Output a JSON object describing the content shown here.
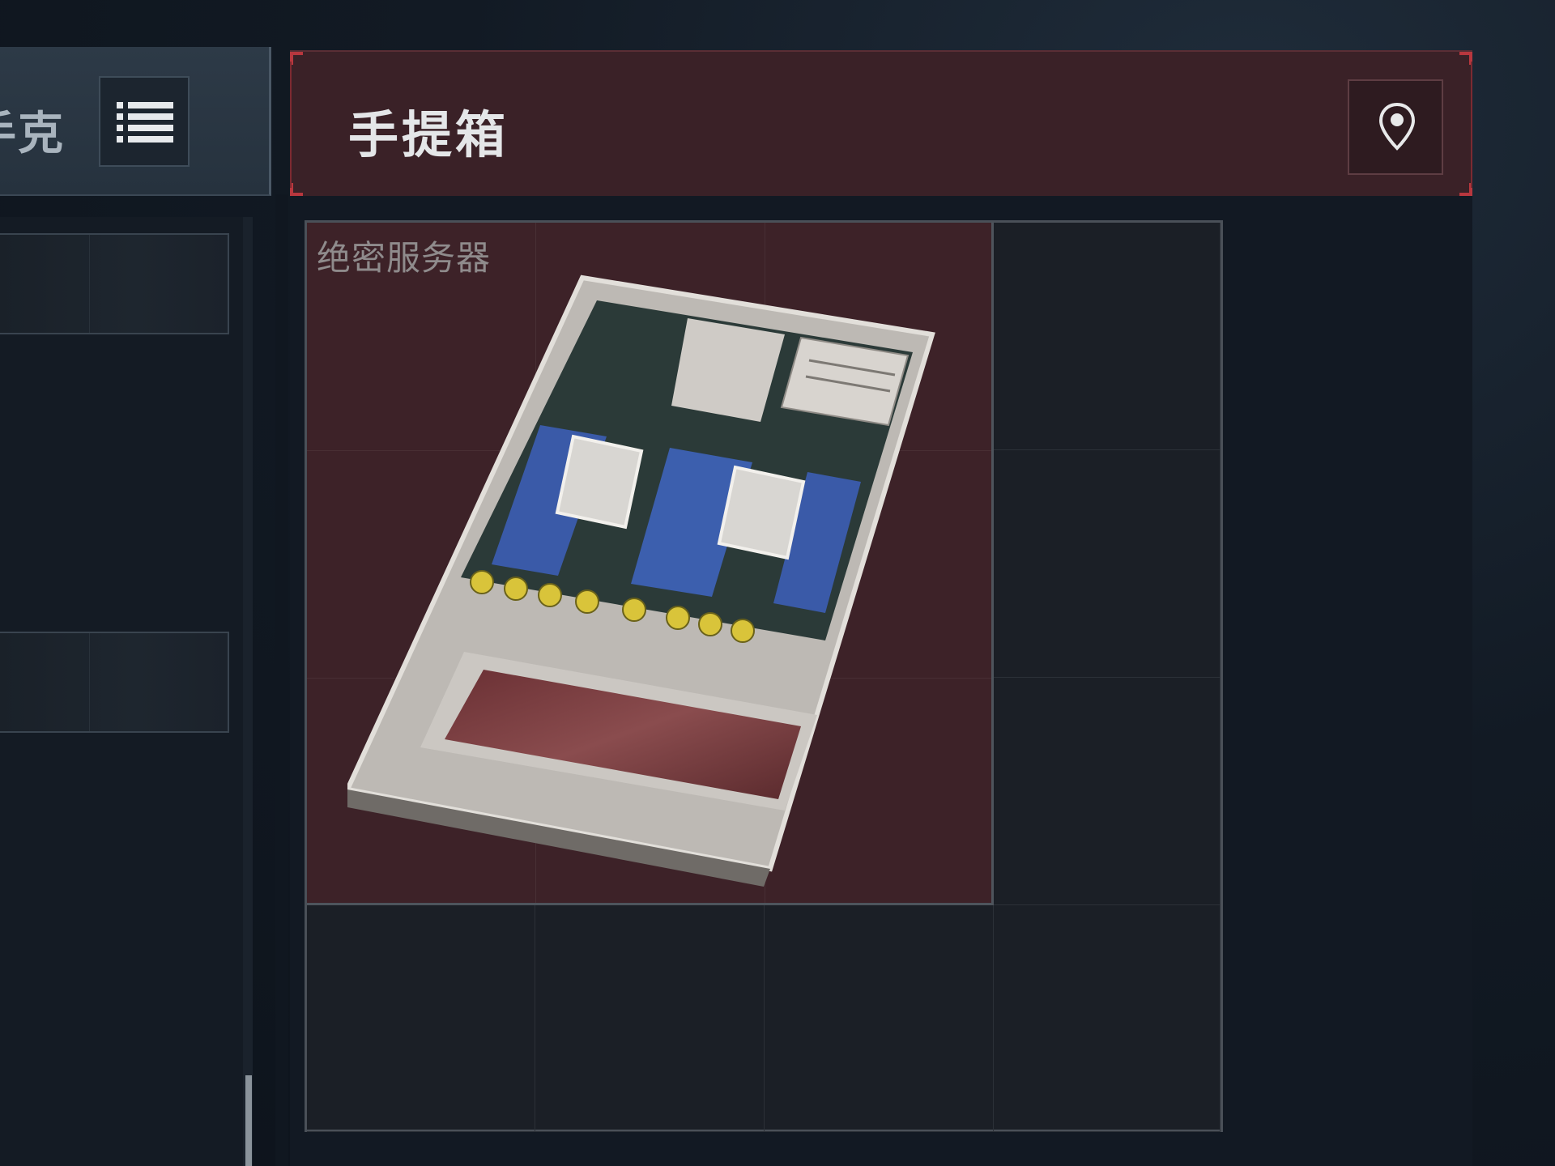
{
  "left_panel": {
    "title": "手克",
    "list_button": {
      "icon": "list-icon"
    }
  },
  "case_panel": {
    "title": "手提箱",
    "pin_button": {
      "icon": "map-pin-icon"
    },
    "grid": {
      "columns": 4,
      "rows": 4
    },
    "items": [
      {
        "name": "绝密服务器",
        "icon": "server-icon",
        "grid_width": 3,
        "grid_height": 3
      }
    ]
  },
  "colors": {
    "item_background": "#3d2228",
    "header_background": "#3a2127",
    "accent_red": "#b8373e"
  }
}
